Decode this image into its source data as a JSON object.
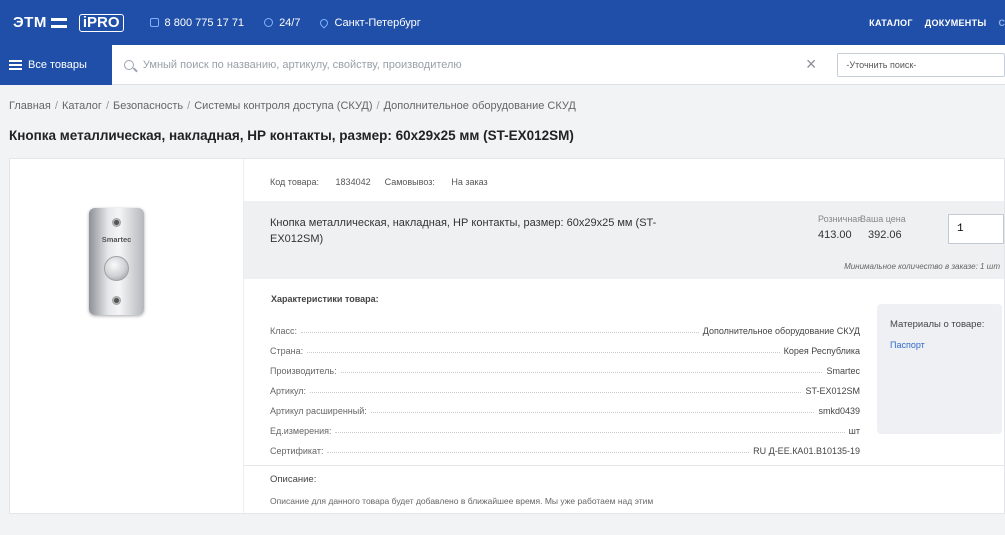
{
  "header": {
    "logo_etm": "ЭТМ",
    "logo_ipro": "iPRO",
    "phone": "8 800 775 17 71",
    "hours": "24/7",
    "city": "Санкт-Петербург",
    "nav": [
      "КАТАЛОГ",
      "ДОКУМЕНТЫ",
      "СМ"
    ]
  },
  "search": {
    "all_goods_label": "Все товары",
    "placeholder": "Умный поиск по названию, артикулу, свойству, производителю",
    "clear_symbol": "×",
    "refine_label": "-Уточнить поиск-"
  },
  "breadcrumb": [
    "Главная",
    "Каталог",
    "Безопасность",
    "Системы контроля доступа (СКУД)",
    "Дополнительное оборудование СКУД"
  ],
  "product": {
    "title": "Кнопка металлическая, накладная, НР контакты, размер: 60х29х25 мм (ST-EX012SM)",
    "image_brand": "Smartec",
    "code_label": "Код товара:",
    "code_value": "1834042",
    "pickup_label": "Самовывоз:",
    "pickup_value": "На заказ",
    "panel_title": "Кнопка металлическая, накладная, НР контакты, размер: 60х29х25 мм (ST-EX012SM)",
    "retail_label": "Розничная",
    "retail_price": "413.00",
    "your_price_label": "Ваша цена",
    "your_price": "392.06",
    "quantity": "1",
    "min_qty_note": "Минимальное количество в заказе: 1 шт"
  },
  "characteristics": {
    "title": "Характеристики товара:",
    "rows": [
      {
        "label": "Класс:",
        "value": "Дополнительное оборудование СКУД"
      },
      {
        "label": "Страна:",
        "value": "Корея Республика"
      },
      {
        "label": "Производитель:",
        "value": "Smartec"
      },
      {
        "label": "Артикул:",
        "value": "ST-EX012SM"
      },
      {
        "label": "Артикул расширенный:",
        "value": "smkd0439"
      },
      {
        "label": "Ед.измерения:",
        "value": "шт"
      },
      {
        "label": "Сертификат:",
        "value": "RU Д-ЕЕ.КА01.В10135-19"
      }
    ]
  },
  "materials": {
    "title": "Материалы о товаре:",
    "link": "Паспорт"
  },
  "description": {
    "title": "Описание:",
    "text": "Описание для данного товара будет добавлено в ближайшее время. Мы уже работаем над этим"
  },
  "colors": {
    "brand_blue": "#1f4fa8",
    "link_blue": "#2f6bc8",
    "page_bg": "#f2f3f5",
    "panel_bg": "#eff0f2"
  }
}
